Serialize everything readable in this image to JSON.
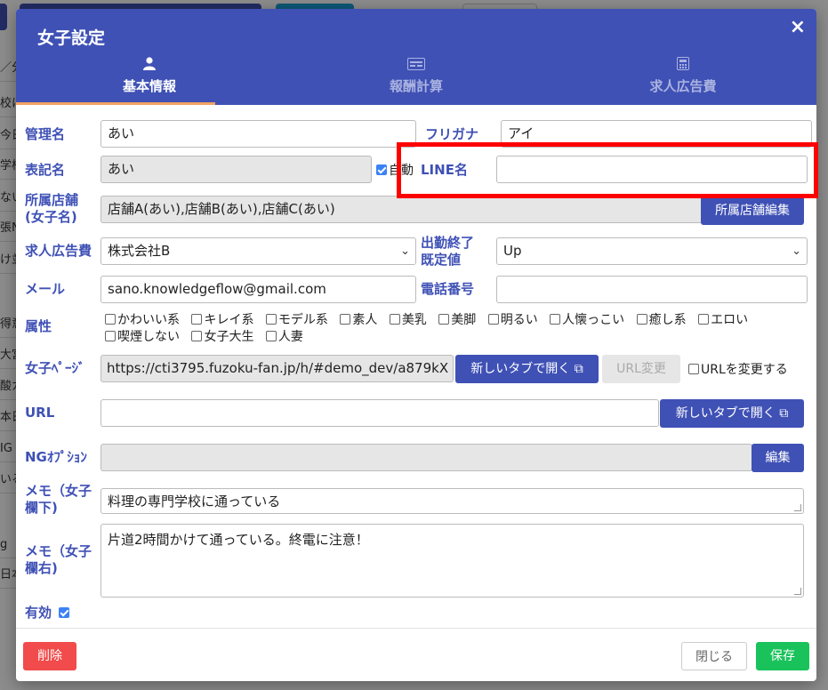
{
  "background": {
    "cells": [
      "／分",
      "校に",
      "今日",
      "学校",
      "ない",
      "張N",
      "け並",
      "得意",
      "大宮",
      "酸ガ",
      "本日",
      "IG",
      "いる",
      "g",
      "日本"
    ]
  },
  "modal": {
    "title": "女子設定",
    "close_icon": "×",
    "tabs": [
      {
        "icon": "user-icon",
        "glyph": "👤",
        "label": "基本情報",
        "active": true
      },
      {
        "icon": "calculator-card-icon",
        "glyph": "▭",
        "label": "報酬計算",
        "active": false
      },
      {
        "icon": "calculator-icon",
        "glyph": "▦",
        "label": "求人広告費",
        "active": false
      }
    ]
  },
  "form": {
    "admin_name": {
      "label": "管理名",
      "value": "あい"
    },
    "furigana": {
      "label": "フリガナ",
      "value": "アイ"
    },
    "display_name": {
      "label": "表記名",
      "value": "あい",
      "auto_label": "自動",
      "auto_checked": true
    },
    "line_name": {
      "label": "LINE名",
      "value": ""
    },
    "store": {
      "label": "所属店舗\n(女子名)",
      "label_line1": "所属店舗",
      "label_line2": "(女子名)",
      "value": "店舗A(あい),店舗B(あい),店舗C(あい)",
      "edit_button": "所属店舗編集"
    },
    "ad_cost": {
      "label": "求人広告費",
      "value": "株式会社B"
    },
    "shift_end": {
      "label_line1": "出勤終了",
      "label_line2": "既定値",
      "value": "Up"
    },
    "email": {
      "label": "メール",
      "value": "sano.knowledgeflow@gmail.com"
    },
    "phone": {
      "label": "電話番号",
      "value": ""
    },
    "attributes": {
      "label": "属性",
      "row1": [
        "かわいい系",
        "キレイ系",
        "モデル系",
        "素人",
        "美乳",
        "美脚",
        "明るい",
        "人懐っこい",
        "癒し系",
        "エロい"
      ],
      "row2": [
        "喫煙しない",
        "女子大生",
        "人妻"
      ]
    },
    "girl_page": {
      "label": "女子ﾍﾟｰｼﾞ",
      "value": "https://cti3795.fuzoku-fan.jp/h/#demo_dev/a879kX",
      "open_button": "新しいタブで開く",
      "change_url_button": "URL変更",
      "change_url_checkbox": "URLを変更する"
    },
    "url": {
      "label": "URL",
      "value": "",
      "open_button": "新しいタブで開く"
    },
    "ng_option": {
      "label": "NGｵﾌﾟｼｮﾝ",
      "value": "",
      "edit_button": "編集"
    },
    "memo_bottom": {
      "label_line1": "メモ（女子",
      "label_line2": "欄下)",
      "value": "料理の専門学校に通っている"
    },
    "memo_right": {
      "label_line1": "メモ（女子",
      "label_line2": "欄右)",
      "value": "片道2時間かけて通っている。終電に注意！"
    },
    "active": {
      "label": "有効",
      "checked": true
    }
  },
  "footer": {
    "delete_button": "削除",
    "close_button": "閉じる",
    "save_button": "保存"
  },
  "colors": {
    "primary": "#3f51b5",
    "danger": "#f14b4b",
    "success": "#19c25a",
    "highlight": "#ff0000"
  }
}
